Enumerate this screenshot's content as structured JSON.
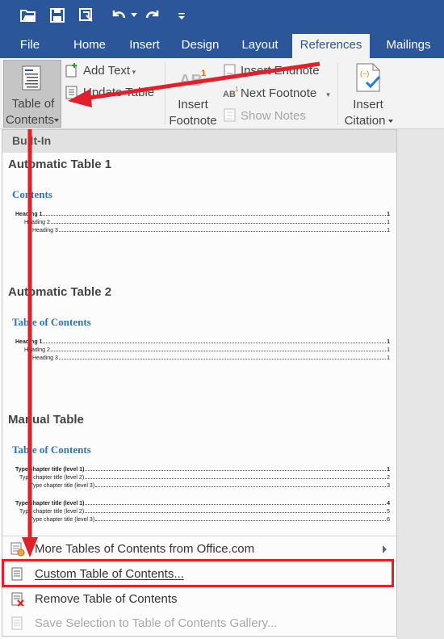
{
  "qat": {
    "icons": [
      "open-folder-icon",
      "save-icon",
      "touch-mode-icon",
      "undo-icon",
      "redo-icon",
      "customize-icon"
    ]
  },
  "tabs": [
    {
      "label": "File"
    },
    {
      "label": "Home"
    },
    {
      "label": "Insert"
    },
    {
      "label": "Design"
    },
    {
      "label": "Layout"
    },
    {
      "label": "References",
      "active": true
    },
    {
      "label": "Mailings"
    }
  ],
  "ribbon": {
    "toc_line1": "Table of",
    "toc_line2": "Contents",
    "add_text": "Add Text",
    "update_table": "Update Table",
    "insert_footnote_line1": "Insert",
    "insert_footnote_line2": "Footnote",
    "insert_endnote": "Insert Endnote",
    "next_footnote": "Next Footnote",
    "show_notes": "Show Notes",
    "insert_citation_line1": "Insert",
    "insert_citation_line2": "Citation"
  },
  "dropdown": {
    "section_header": "Built-In",
    "galleries": [
      {
        "title": "Automatic Table 1",
        "heading": "Contents",
        "lines": [
          {
            "text": "Heading 1",
            "page": "1"
          },
          {
            "text": "Heading 2",
            "page": "1"
          },
          {
            "text": "Heading 3",
            "page": "1"
          }
        ]
      },
      {
        "title": "Automatic Table 2",
        "heading": "Table of Contents",
        "lines": [
          {
            "text": "Heading 1",
            "page": "1"
          },
          {
            "text": "Heading 2",
            "page": "1"
          },
          {
            "text": "Heading 3",
            "page": "1"
          }
        ]
      },
      {
        "title": "Manual Table",
        "heading": "Table of Contents",
        "lines": [
          {
            "text": "Type chapter title (level 1)",
            "page": "1"
          },
          {
            "text": "Type chapter title (level 2)",
            "page": "2"
          },
          {
            "text": "Type chapter title (level 3)",
            "page": "3"
          },
          {
            "text": "Type chapter title (level 1)",
            "page": "4"
          },
          {
            "text": "Type chapter title (level 2)",
            "page": "5"
          },
          {
            "text": "Type chapter title (level 3)",
            "page": "6"
          }
        ]
      }
    ],
    "menu": {
      "more_tables": "More Tables of Contents from Office.com",
      "custom_table": "Custom Table of Contents...",
      "remove_table": "Remove Table of Contents",
      "save_selection": "Save Selection to Table of Contents Gallery..."
    }
  },
  "colors": {
    "title_bar": "#2b579a",
    "annotation_red": "#e0202a",
    "toc_heading_blue": "#2e74b5"
  }
}
